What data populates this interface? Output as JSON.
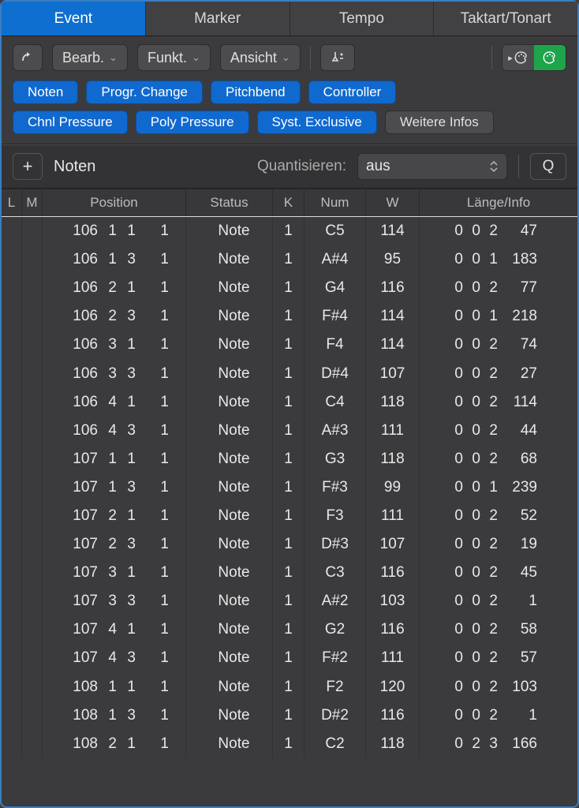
{
  "tabs": [
    "Event",
    "Marker",
    "Tempo",
    "Taktart/Tonart"
  ],
  "active_tab": 0,
  "menus": {
    "edit": "Bearb.",
    "func": "Funkt.",
    "view": "Ansicht"
  },
  "filters": {
    "row1": [
      "Noten",
      "Progr. Change",
      "Pitchbend",
      "Controller"
    ],
    "row2": [
      "Chnl Pressure",
      "Poly Pressure",
      "Syst. Exclusive",
      "Weitere Infos"
    ],
    "row2_grey_index": 3
  },
  "create": {
    "type_label": "Noten",
    "quantize_label": "Quantisieren:",
    "quantize_value": "aus",
    "q_button": "Q"
  },
  "columns": {
    "L": "L",
    "M": "M",
    "pos": "Position",
    "status": "Status",
    "K": "K",
    "num": "Num",
    "W": "W",
    "len": "Länge/Info"
  },
  "rows": [
    {
      "pos": [
        "106",
        "1",
        "1",
        "1"
      ],
      "status": "Note",
      "k": "1",
      "num": "C5",
      "w": "114",
      "len": [
        "0",
        "0",
        "2",
        "47"
      ]
    },
    {
      "pos": [
        "106",
        "1",
        "3",
        "1"
      ],
      "status": "Note",
      "k": "1",
      "num": "A#4",
      "w": "95",
      "len": [
        "0",
        "0",
        "1",
        "183"
      ]
    },
    {
      "pos": [
        "106",
        "2",
        "1",
        "1"
      ],
      "status": "Note",
      "k": "1",
      "num": "G4",
      "w": "116",
      "len": [
        "0",
        "0",
        "2",
        "77"
      ]
    },
    {
      "pos": [
        "106",
        "2",
        "3",
        "1"
      ],
      "status": "Note",
      "k": "1",
      "num": "F#4",
      "w": "114",
      "len": [
        "0",
        "0",
        "1",
        "218"
      ]
    },
    {
      "pos": [
        "106",
        "3",
        "1",
        "1"
      ],
      "status": "Note",
      "k": "1",
      "num": "F4",
      "w": "114",
      "len": [
        "0",
        "0",
        "2",
        "74"
      ]
    },
    {
      "pos": [
        "106",
        "3",
        "3",
        "1"
      ],
      "status": "Note",
      "k": "1",
      "num": "D#4",
      "w": "107",
      "len": [
        "0",
        "0",
        "2",
        "27"
      ]
    },
    {
      "pos": [
        "106",
        "4",
        "1",
        "1"
      ],
      "status": "Note",
      "k": "1",
      "num": "C4",
      "w": "118",
      "len": [
        "0",
        "0",
        "2",
        "114"
      ]
    },
    {
      "pos": [
        "106",
        "4",
        "3",
        "1"
      ],
      "status": "Note",
      "k": "1",
      "num": "A#3",
      "w": "111",
      "len": [
        "0",
        "0",
        "2",
        "44"
      ]
    },
    {
      "pos": [
        "107",
        "1",
        "1",
        "1"
      ],
      "status": "Note",
      "k": "1",
      "num": "G3",
      "w": "118",
      "len": [
        "0",
        "0",
        "2",
        "68"
      ]
    },
    {
      "pos": [
        "107",
        "1",
        "3",
        "1"
      ],
      "status": "Note",
      "k": "1",
      "num": "F#3",
      "w": "99",
      "len": [
        "0",
        "0",
        "1",
        "239"
      ]
    },
    {
      "pos": [
        "107",
        "2",
        "1",
        "1"
      ],
      "status": "Note",
      "k": "1",
      "num": "F3",
      "w": "111",
      "len": [
        "0",
        "0",
        "2",
        "52"
      ]
    },
    {
      "pos": [
        "107",
        "2",
        "3",
        "1"
      ],
      "status": "Note",
      "k": "1",
      "num": "D#3",
      "w": "107",
      "len": [
        "0",
        "0",
        "2",
        "19"
      ]
    },
    {
      "pos": [
        "107",
        "3",
        "1",
        "1"
      ],
      "status": "Note",
      "k": "1",
      "num": "C3",
      "w": "116",
      "len": [
        "0",
        "0",
        "2",
        "45"
      ]
    },
    {
      "pos": [
        "107",
        "3",
        "3",
        "1"
      ],
      "status": "Note",
      "k": "1",
      "num": "A#2",
      "w": "103",
      "len": [
        "0",
        "0",
        "2",
        "1"
      ]
    },
    {
      "pos": [
        "107",
        "4",
        "1",
        "1"
      ],
      "status": "Note",
      "k": "1",
      "num": "G2",
      "w": "116",
      "len": [
        "0",
        "0",
        "2",
        "58"
      ]
    },
    {
      "pos": [
        "107",
        "4",
        "3",
        "1"
      ],
      "status": "Note",
      "k": "1",
      "num": "F#2",
      "w": "111",
      "len": [
        "0",
        "0",
        "2",
        "57"
      ]
    },
    {
      "pos": [
        "108",
        "1",
        "1",
        "1"
      ],
      "status": "Note",
      "k": "1",
      "num": "F2",
      "w": "120",
      "len": [
        "0",
        "0",
        "2",
        "103"
      ]
    },
    {
      "pos": [
        "108",
        "1",
        "3",
        "1"
      ],
      "status": "Note",
      "k": "1",
      "num": "D#2",
      "w": "116",
      "len": [
        "0",
        "0",
        "2",
        "1"
      ]
    },
    {
      "pos": [
        "108",
        "2",
        "1",
        "1"
      ],
      "status": "Note",
      "k": "1",
      "num": "C2",
      "w": "118",
      "len": [
        "0",
        "2",
        "3",
        "166"
      ]
    }
  ]
}
